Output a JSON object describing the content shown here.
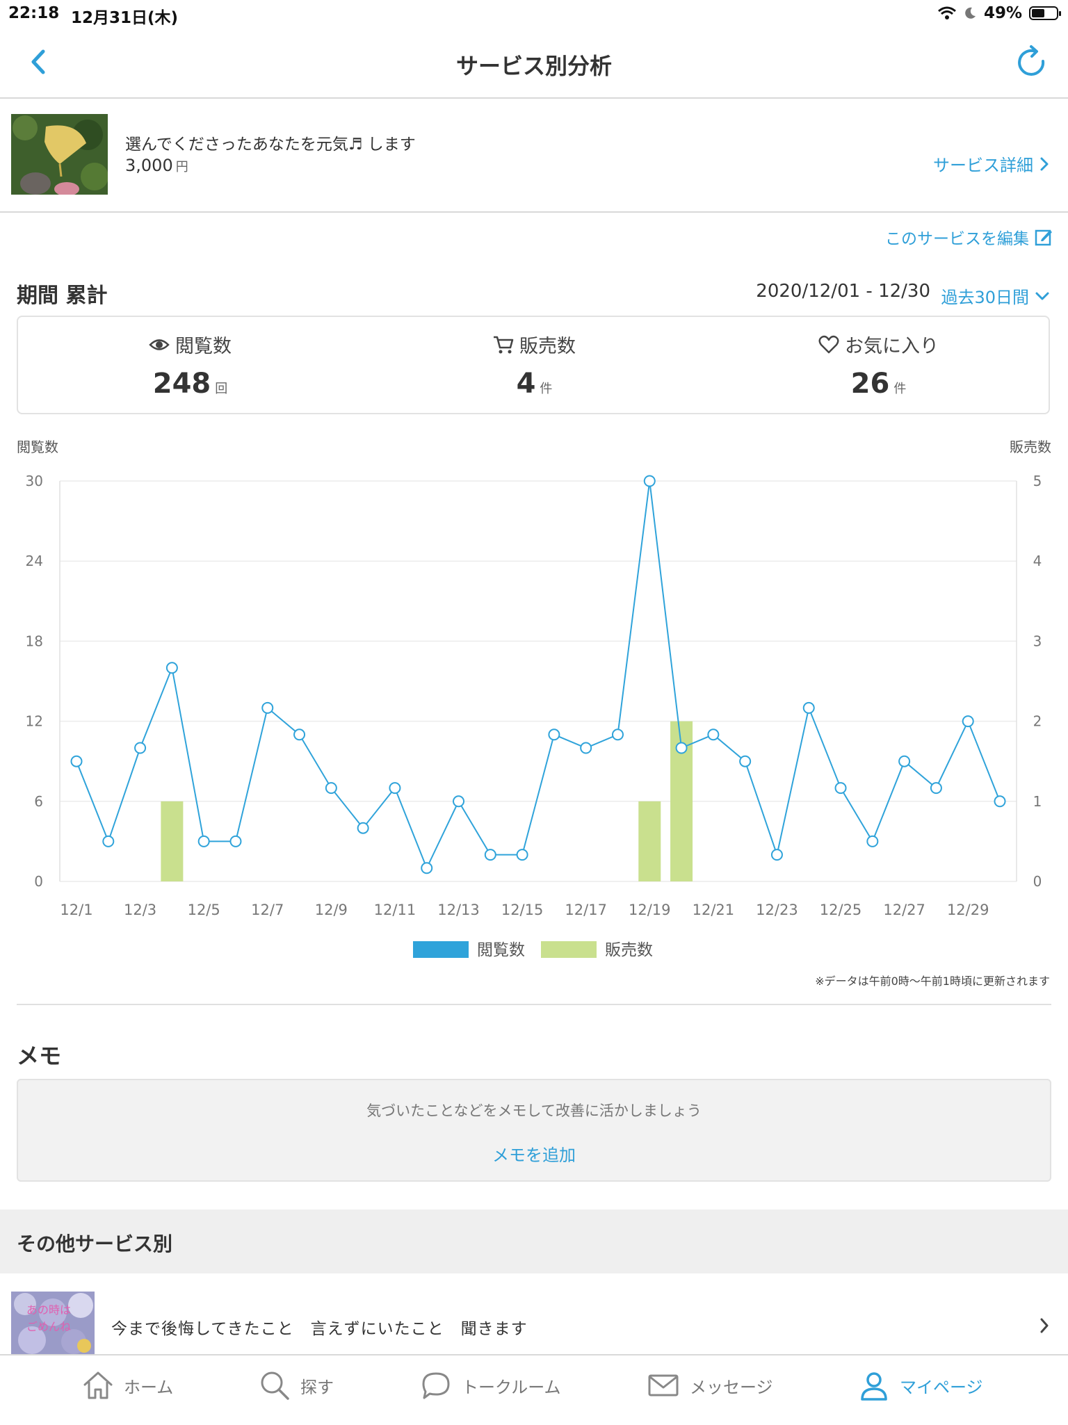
{
  "status_bar": {
    "time": "22:18",
    "date": "12月31日(木)",
    "battery": "49%"
  },
  "nav": {
    "title": "サービス別分析"
  },
  "service": {
    "name": "選んでくださったあなたを元気♬ します",
    "price": "3,000",
    "price_unit": "円",
    "detail_link": "サービス詳細",
    "edit_link": "このサービスを編集"
  },
  "period": {
    "label": "期間 累計",
    "range": "2020/12/01 - 12/30",
    "select": "過去30日間"
  },
  "stats": [
    {
      "label": "閲覧数",
      "value": "248",
      "unit": "回",
      "icon": "eye-icon"
    },
    {
      "label": "販売数",
      "value": "4",
      "unit": "件",
      "icon": "cart-icon"
    },
    {
      "label": "お気に入り",
      "value": "26",
      "unit": "件",
      "icon": "heart-icon"
    }
  ],
  "chart_data": {
    "type": "line",
    "ylabel_left": "閲覧数",
    "ylabel_right": "販売数",
    "y_left_ticks": [
      "0",
      "6",
      "12",
      "18",
      "24",
      "30"
    ],
    "y_right_ticks": [
      "0",
      "1",
      "2",
      "3",
      "4",
      "5"
    ],
    "ylim_left": [
      0,
      30
    ],
    "ylim_right": [
      0,
      5
    ],
    "x_tick_labels": [
      "12/1",
      "12/3",
      "12/5",
      "12/7",
      "12/9",
      "12/11",
      "12/13",
      "12/15",
      "12/17",
      "12/19",
      "12/21",
      "12/23",
      "12/25",
      "12/27",
      "12/29"
    ],
    "x": [
      "12/1",
      "12/2",
      "12/3",
      "12/4",
      "12/5",
      "12/6",
      "12/7",
      "12/8",
      "12/9",
      "12/10",
      "12/11",
      "12/12",
      "12/13",
      "12/14",
      "12/15",
      "12/16",
      "12/17",
      "12/18",
      "12/19",
      "12/20",
      "12/21",
      "12/22",
      "12/23",
      "12/24",
      "12/25",
      "12/26",
      "12/27",
      "12/28",
      "12/29",
      "12/30"
    ],
    "series": [
      {
        "name": "閲覧数",
        "kind": "line",
        "axis": "left",
        "color": "#2fa3da",
        "values": [
          9,
          3,
          10,
          16,
          3,
          3,
          13,
          11,
          7,
          4,
          7,
          1,
          6,
          2,
          2,
          11,
          10,
          11,
          30,
          10,
          11,
          9,
          2,
          13,
          7,
          3,
          9,
          7,
          12,
          6
        ]
      },
      {
        "name": "販売数",
        "kind": "bar",
        "axis": "right",
        "color": "#c9e08e",
        "values": [
          0,
          0,
          0,
          1,
          0,
          0,
          0,
          0,
          0,
          0,
          0,
          0,
          0,
          0,
          0,
          0,
          0,
          0,
          1,
          2,
          0,
          0,
          0,
          0,
          0,
          0,
          0,
          0,
          0,
          0
        ]
      }
    ],
    "grid": true,
    "legend": "bottom-center"
  },
  "chart_note": "※データは午前0時〜午前1時頃に更新されます",
  "memo": {
    "title": "メモ",
    "hint": "気づいたことなどをメモして改善に活かしましょう",
    "add": "メモを追加"
  },
  "other": {
    "title": "その他サービス別",
    "item_text": "今まで後悔してきたこと　言えずにいたこと　聞きます",
    "thumb_text_1": "あの時は",
    "thumb_text_2": "ごめんね"
  },
  "tabs": [
    {
      "label": "ホーム",
      "icon": "home-icon"
    },
    {
      "label": "探す",
      "icon": "search-icon"
    },
    {
      "label": "トークルーム",
      "icon": "chat-bubble-icon"
    },
    {
      "label": "メッセージ",
      "icon": "mail-icon"
    },
    {
      "label": "マイページ",
      "icon": "person-icon",
      "active": true
    }
  ],
  "colors": {
    "accent": "#2f9fd8",
    "line": "#2fa3da",
    "bar": "#c9e08e"
  }
}
